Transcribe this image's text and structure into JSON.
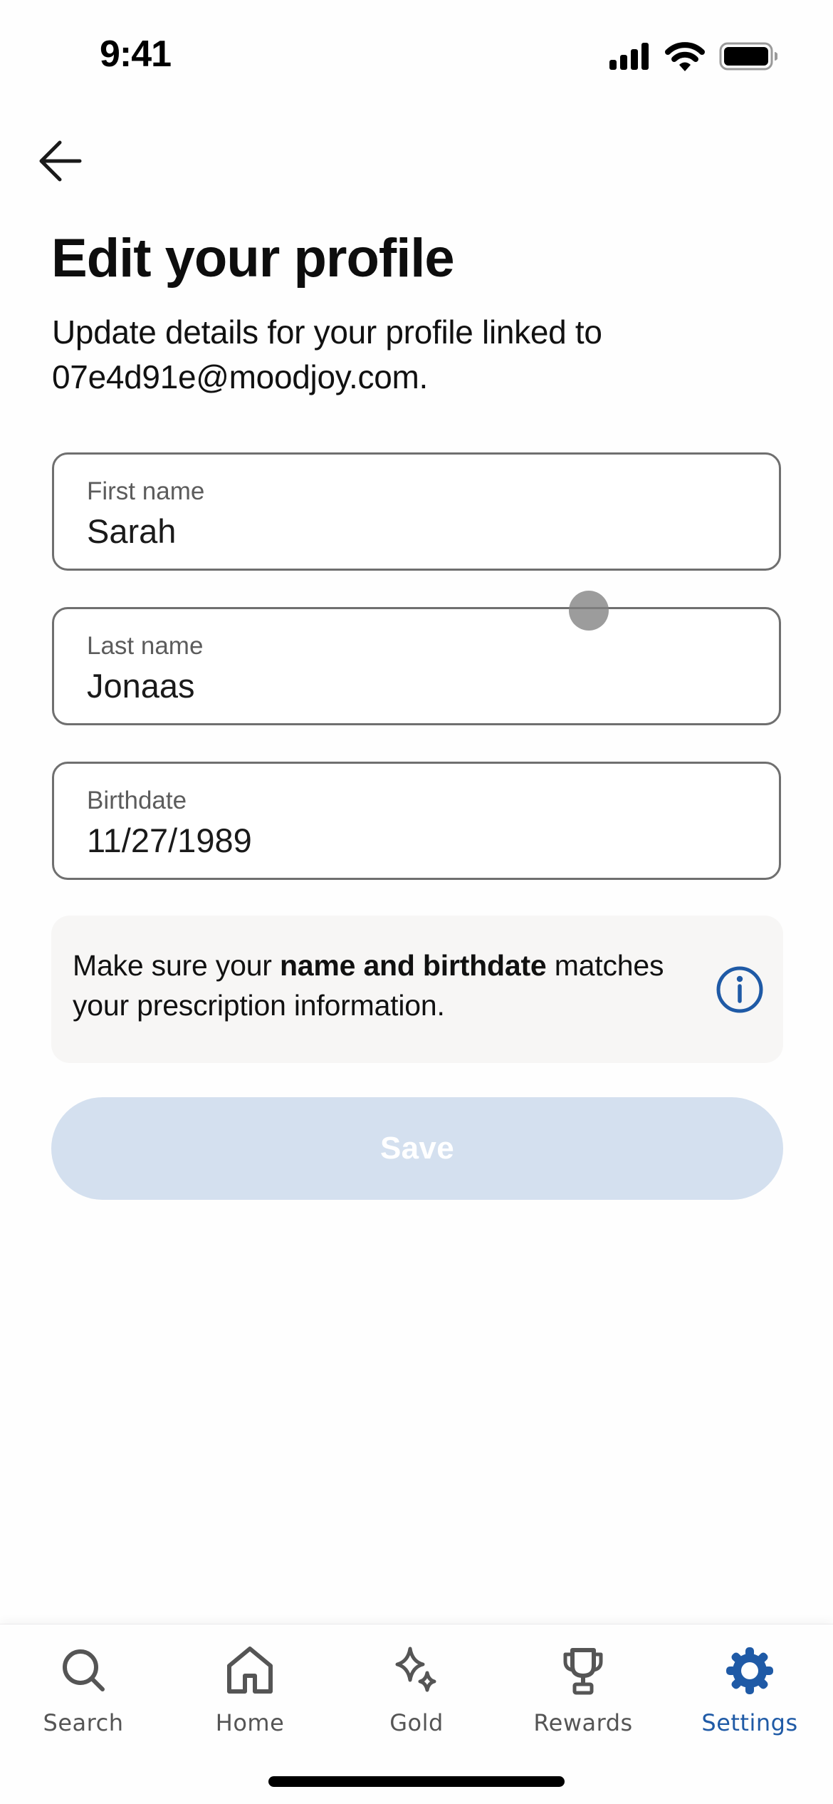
{
  "status_bar": {
    "time": "9:41",
    "icons": [
      "signal-icon",
      "wifi-icon",
      "battery-icon"
    ]
  },
  "nav": {
    "back_icon": "arrow-left-icon"
  },
  "header": {
    "title": "Edit your profile",
    "subtitle": "Update details for your profile linked to 07e4d91e@moodjoy.com."
  },
  "form": {
    "first_name": {
      "label": "First name",
      "value": "Sarah"
    },
    "last_name": {
      "label": "Last name",
      "value": "Jonaas"
    },
    "birthdate": {
      "label": "Birthdate",
      "value": "11/27/1989"
    }
  },
  "info": {
    "text_before": "Make sure your ",
    "text_bold": "name and birthdate",
    "text_after": " matches your prescription information.",
    "icon": "info-circle-icon"
  },
  "actions": {
    "save_label": "Save",
    "save_enabled": false
  },
  "tab_bar": {
    "active": "Settings",
    "items": [
      {
        "label": "Search",
        "icon": "search-icon"
      },
      {
        "label": "Home",
        "icon": "home-icon"
      },
      {
        "label": "Gold",
        "icon": "sparkles-icon"
      },
      {
        "label": "Rewards",
        "icon": "trophy-icon"
      },
      {
        "label": "Settings",
        "icon": "gear-icon"
      }
    ]
  },
  "colors": {
    "accent": "#1f5aa6",
    "save_disabled_bg": "#d4e0ef",
    "info_bg": "#f7f6f5",
    "field_border": "#6f6f6f",
    "inactive_tab": "#555555"
  }
}
